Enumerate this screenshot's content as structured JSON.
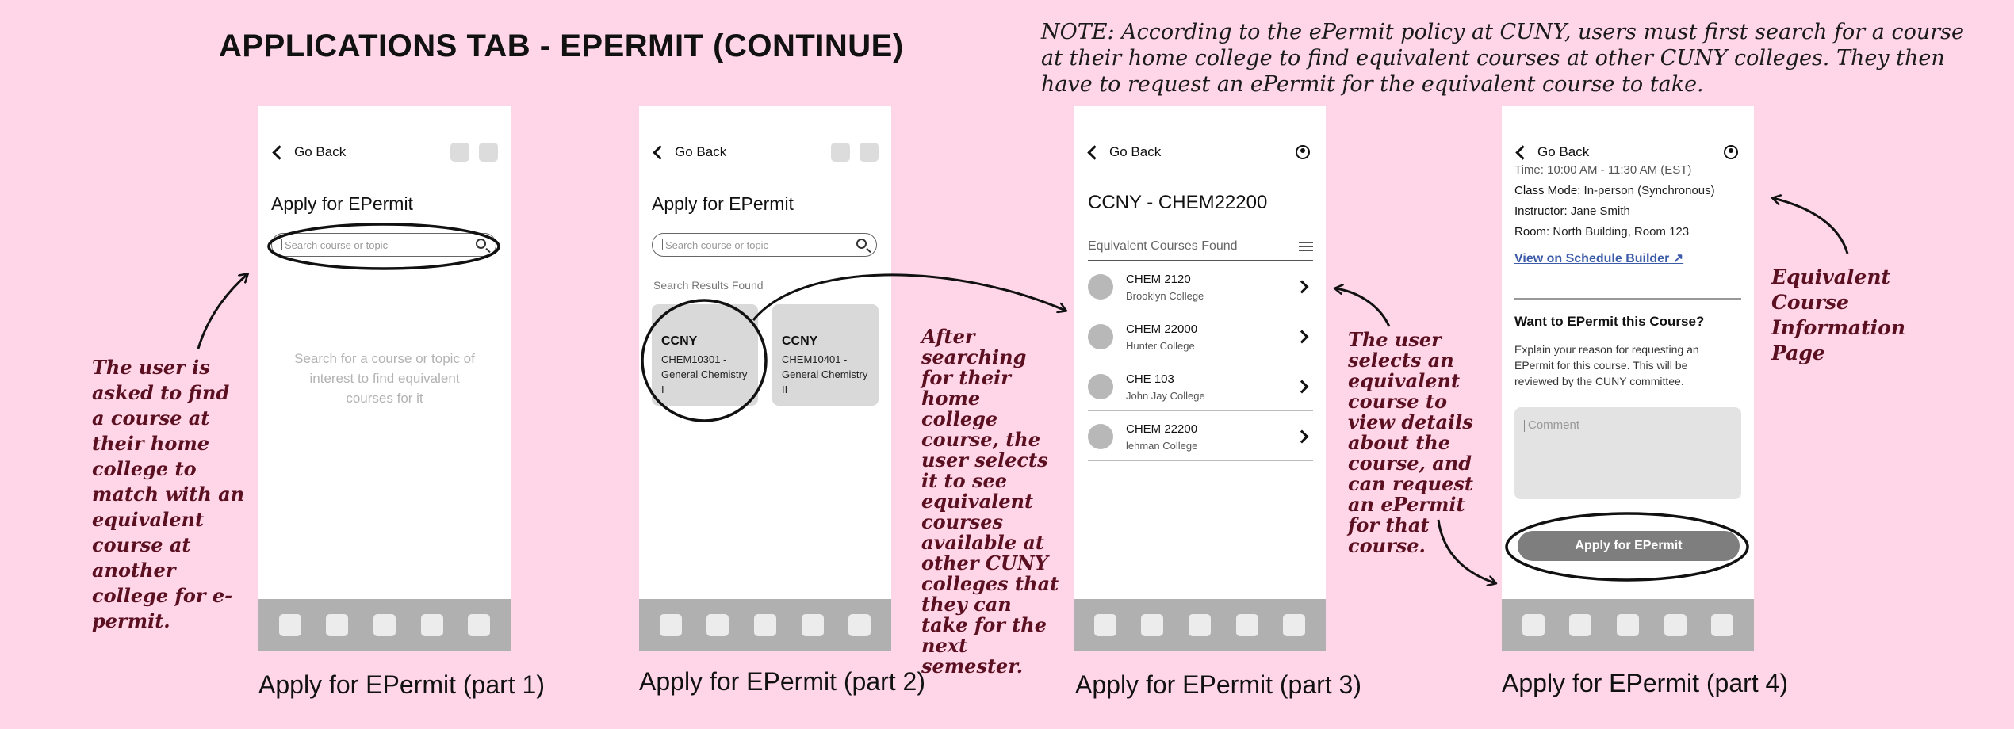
{
  "main_title": "APPLICATIONS TAB - EPERMIT (CONTINUE)",
  "note": "NOTE: According to the ePermit policy at CUNY, users must first search for a course at their home college to find equivalent courses at other CUNY colleges. They then have to request an ePermit for the equivalent course to take.",
  "annotations": {
    "part1": "The user is asked to find a course at their home college to match with an equivalent course at another college for e-permit.",
    "part2": "After searching for their home college course, the user selects it to see equivalent courses available at other CUNY colleges that they can take for the next semester.",
    "part3": "The user selects an equivalent course to view details about the course, and can request an ePermit for that course.",
    "part4": "Equivalent Course Information Page"
  },
  "captions": {
    "part1": "Apply for EPermit (part 1)",
    "part2": "Apply for EPermit (part 2)",
    "part3": "Apply for EPermit (part 3)",
    "part4": "Apply for EPermit (part 4)"
  },
  "common": {
    "back_label": "Go Back",
    "search_placeholder": "Search course or topic"
  },
  "screen1": {
    "title": "Apply for EPermit",
    "empty_text": "Search for a course or topic of interest to find equivalent courses for it"
  },
  "screen2": {
    "title": "Apply for EPermit",
    "results_label": "Search Results Found",
    "results": [
      {
        "college": "CCNY",
        "course": "CHEM10301 - General Chemistry I"
      },
      {
        "college": "CCNY",
        "course": "CHEM10401 - General Chemistry II"
      }
    ]
  },
  "screen3": {
    "title": "CCNY -  CHEM22200",
    "list_header": "Equivalent Courses Found",
    "courses": [
      {
        "code": "CHEM 2120",
        "college": "Brooklyn College"
      },
      {
        "code": "CHEM 22000",
        "college": "Hunter College"
      },
      {
        "code": "CHE 103",
        "college": "John Jay College"
      },
      {
        "code": "CHEM 22200",
        "college": "lehman College"
      }
    ]
  },
  "screen4": {
    "time_row": "Time: 10:00 AM - 11:30 AM (EST)",
    "class_mode_label": "Class Mode:",
    "class_mode_value": "In-person (Synchronous)",
    "instructor_label": "Instructor:",
    "instructor_value": "Jane Smith",
    "room_label": "Room:",
    "room_value": "North Building, Room 123",
    "link_label": "View on Schedule Builder ↗",
    "question_title": "Want to EPermit this Course?",
    "question_desc": "Explain your reason for requesting an EPermit for this course. This will be reviewed by the CUNY committee.",
    "comment_placeholder": "Comment",
    "apply_button": "Apply for EPermit"
  }
}
